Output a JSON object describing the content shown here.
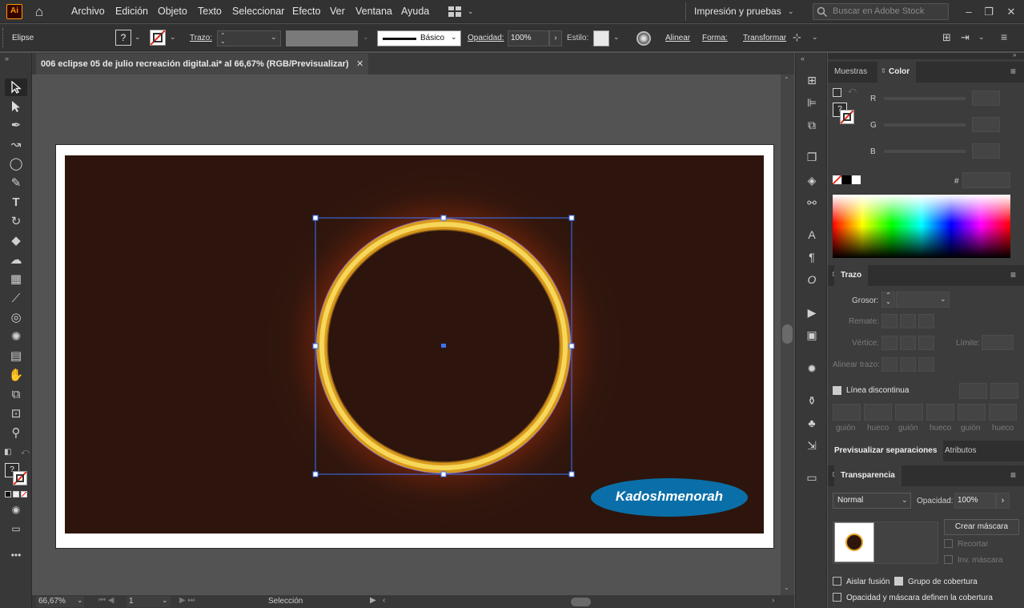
{
  "menubar": {
    "app_logo": "Ai",
    "items": [
      "Archivo",
      "Edición",
      "Objeto",
      "Texto",
      "Seleccionar",
      "Efecto",
      "Ver",
      "Ventana",
      "Ayuda"
    ],
    "workspace": "Impresión y pruebas",
    "search_placeholder": "Buscar en Adobe Stock"
  },
  "control": {
    "object_type": "Elipse",
    "trazo_label": "Trazo:",
    "brush_label": "Básico",
    "opacity_label": "Opacidad:",
    "opacity_value": "100%",
    "style_label": "Estilo:",
    "align_label": "Alinear",
    "shape_label": "Forma:",
    "transform_label": "Transformar"
  },
  "document": {
    "tab_title": "006 eclipse 05 de julio recreación digital.ai* al 66,67% (RGB/Previsualizar)",
    "watermark": "Kadoshmenorah"
  },
  "status": {
    "zoom": "66,67%",
    "artboard_number": "1",
    "tool": "Selección"
  },
  "panels": {
    "color": {
      "tabs": [
        "Muestras",
        "Color"
      ],
      "channels": [
        "R",
        "G",
        "B"
      ],
      "hash": "#"
    },
    "stroke": {
      "title": "Trazo",
      "weight_label": "Grosor:",
      "cap_label": "Remate:",
      "corner_label": "Vértice:",
      "limit_label": "Límite:",
      "align_label": "Alinear trazo:",
      "dashed_label": "Línea discontinua",
      "dash_labels": [
        "guión",
        "hueco",
        "guión",
        "hueco",
        "guión",
        "hueco"
      ]
    },
    "separations_tabs": [
      "Previsualizar separaciones",
      "Atributos"
    ],
    "transparency": {
      "title": "Transparencia",
      "blend_mode": "Normal",
      "opacity_label": "Opacidad:",
      "opacity_value": "100%",
      "mask_button": "Crear máscara",
      "clip_label": "Recortar",
      "invert_label": "Inv. máscara",
      "isolate_label": "Aislar fusión",
      "knockout_label": "Grupo de cobertura",
      "opacity_mask_label": "Opacidad y máscara definen la cobertura"
    }
  }
}
